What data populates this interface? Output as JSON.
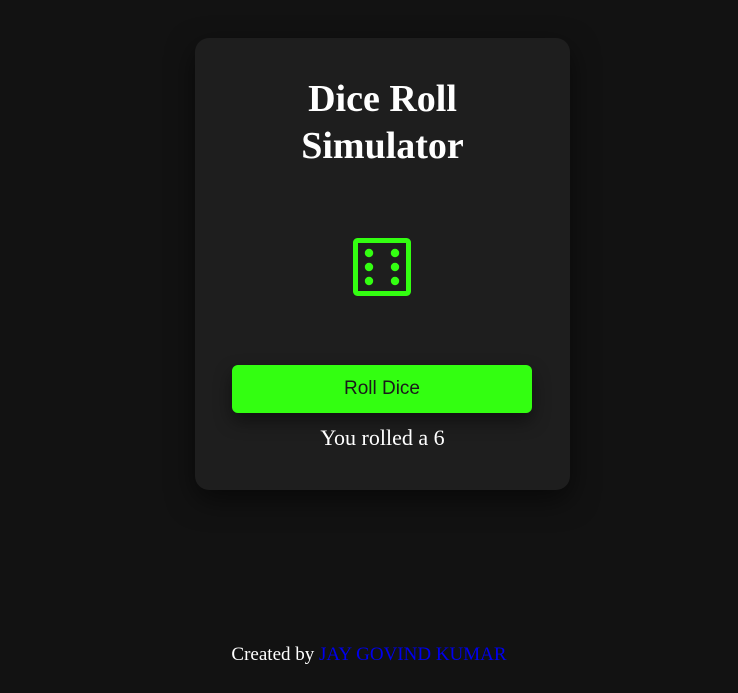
{
  "app": {
    "title_line1": "Dice Roll",
    "title_line2": "Simulator"
  },
  "dice": {
    "value": 6,
    "icon": "die-face-six-icon",
    "color": "#33ff11"
  },
  "roll_button": {
    "label": "Roll Dice",
    "color": "#33ff11"
  },
  "result": {
    "text": "You rolled a 6"
  },
  "footer": {
    "prefix": "Created by ",
    "author": "JAY GOVIND KUMAR",
    "link_color": "#0000ee"
  },
  "colors": {
    "background": "#121212",
    "card": "#1e1e1e",
    "text": "#ffffff"
  }
}
